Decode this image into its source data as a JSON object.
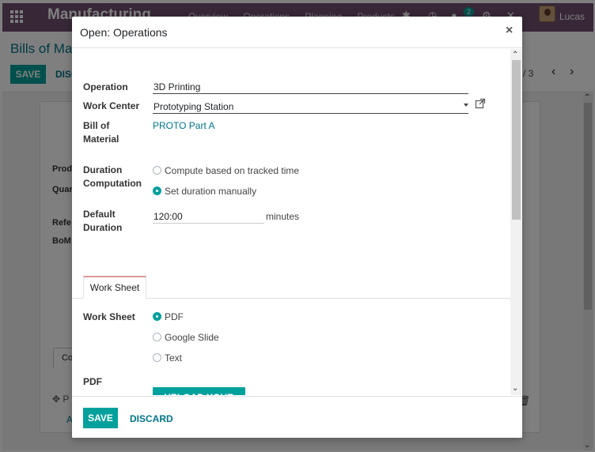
{
  "app": {
    "title": "Manufacturing",
    "menus": [
      "Overview",
      "Operations",
      "Planning",
      "Products"
    ],
    "chat_count": "2",
    "user_name": "Lucas"
  },
  "control_panel": {
    "breadcrumb": "Bills of Mat",
    "save_label": "SAVE",
    "discard_label": "DISC",
    "pager": "/ 3"
  },
  "background_form": {
    "labels": [
      "Prod",
      "Quar",
      "Refe",
      "BoM"
    ],
    "tab_label": "Co",
    "row_text": "P",
    "row_link": "A"
  },
  "modal": {
    "title": "Open: Operations",
    "fields": {
      "operation_label": "Operation",
      "operation_value": "3D Printing",
      "work_center_label": "Work Center",
      "work_center_value": "Prototyping Station",
      "bom_label_1": "Bill of",
      "bom_label_2": "Material",
      "bom_value": "PROTO Part A",
      "duration_comp_label_1": "Duration",
      "duration_comp_label_2": "Computation",
      "duration_options": [
        "Compute based on tracked time",
        "Set duration manually"
      ],
      "duration_selected": "Set duration manually",
      "default_duration_label_1": "Default",
      "default_duration_label_2": "Duration",
      "default_duration_value": "120:00",
      "default_duration_unit": "minutes"
    },
    "tabs": {
      "work_sheet": "Work Sheet"
    },
    "work_sheet": {
      "label": "Work Sheet",
      "options": [
        "PDF",
        "Google Slide",
        "Text"
      ],
      "selected": "PDF",
      "pdf_label": "PDF",
      "upload_label": "UPLOAD YOUR FILE"
    },
    "footer": {
      "save_label": "SAVE",
      "discard_label": "DISCARD"
    }
  },
  "colors": {
    "brand": "#6f4f6e",
    "primary": "#00a09d",
    "link": "#00748a"
  }
}
